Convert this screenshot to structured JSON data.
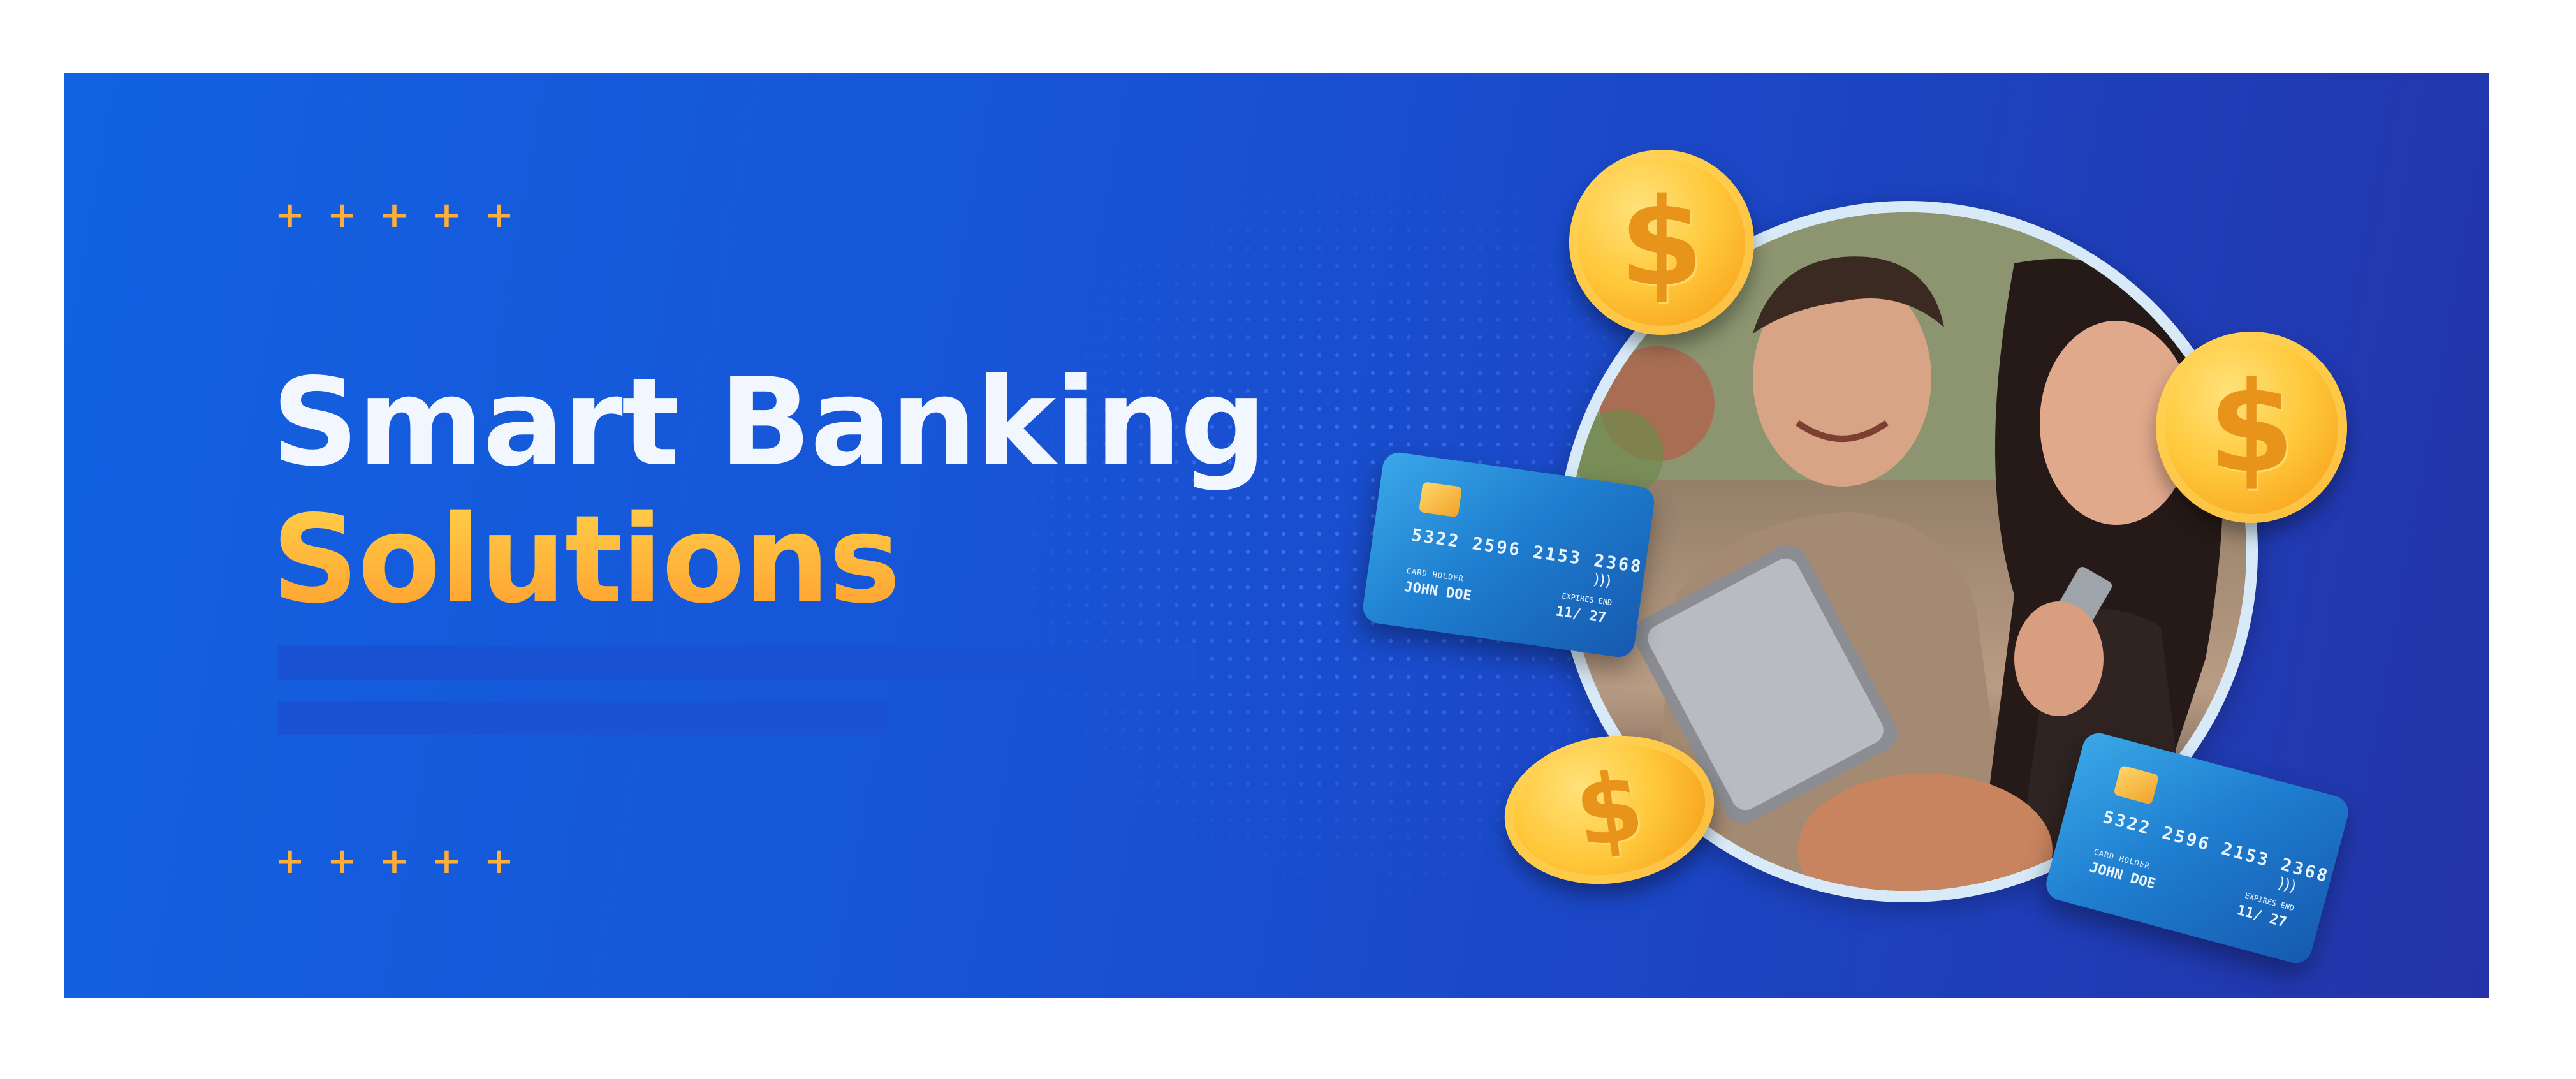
{
  "headline": {
    "line1": "Smart Banking",
    "line2": "Solutions"
  },
  "decor": {
    "plus_glyph": "+",
    "plus_count_per_row": 5
  },
  "cards": [
    {
      "number": "5322 2596 2153 2368",
      "holder_label": "CARD HOLDER",
      "holder": "JOHN DOE",
      "expires_label": "EXPIRES END",
      "expires": "11/ 27"
    },
    {
      "number": "5322 2596 2153 2368",
      "holder_label": "CARD HOLDER",
      "holder": "JOHN DOE",
      "expires_label": "EXPIRES END",
      "expires": "11/ 27"
    }
  ],
  "coin_symbol": "$",
  "colors": {
    "background": "#1754d6",
    "accent": "#ffae3a",
    "headline": "#f2f7ff"
  },
  "icons": {
    "plus": "plus-icon",
    "coin": "dollar-coin-icon",
    "chip": "card-chip-icon",
    "contactless": "contactless-icon"
  }
}
